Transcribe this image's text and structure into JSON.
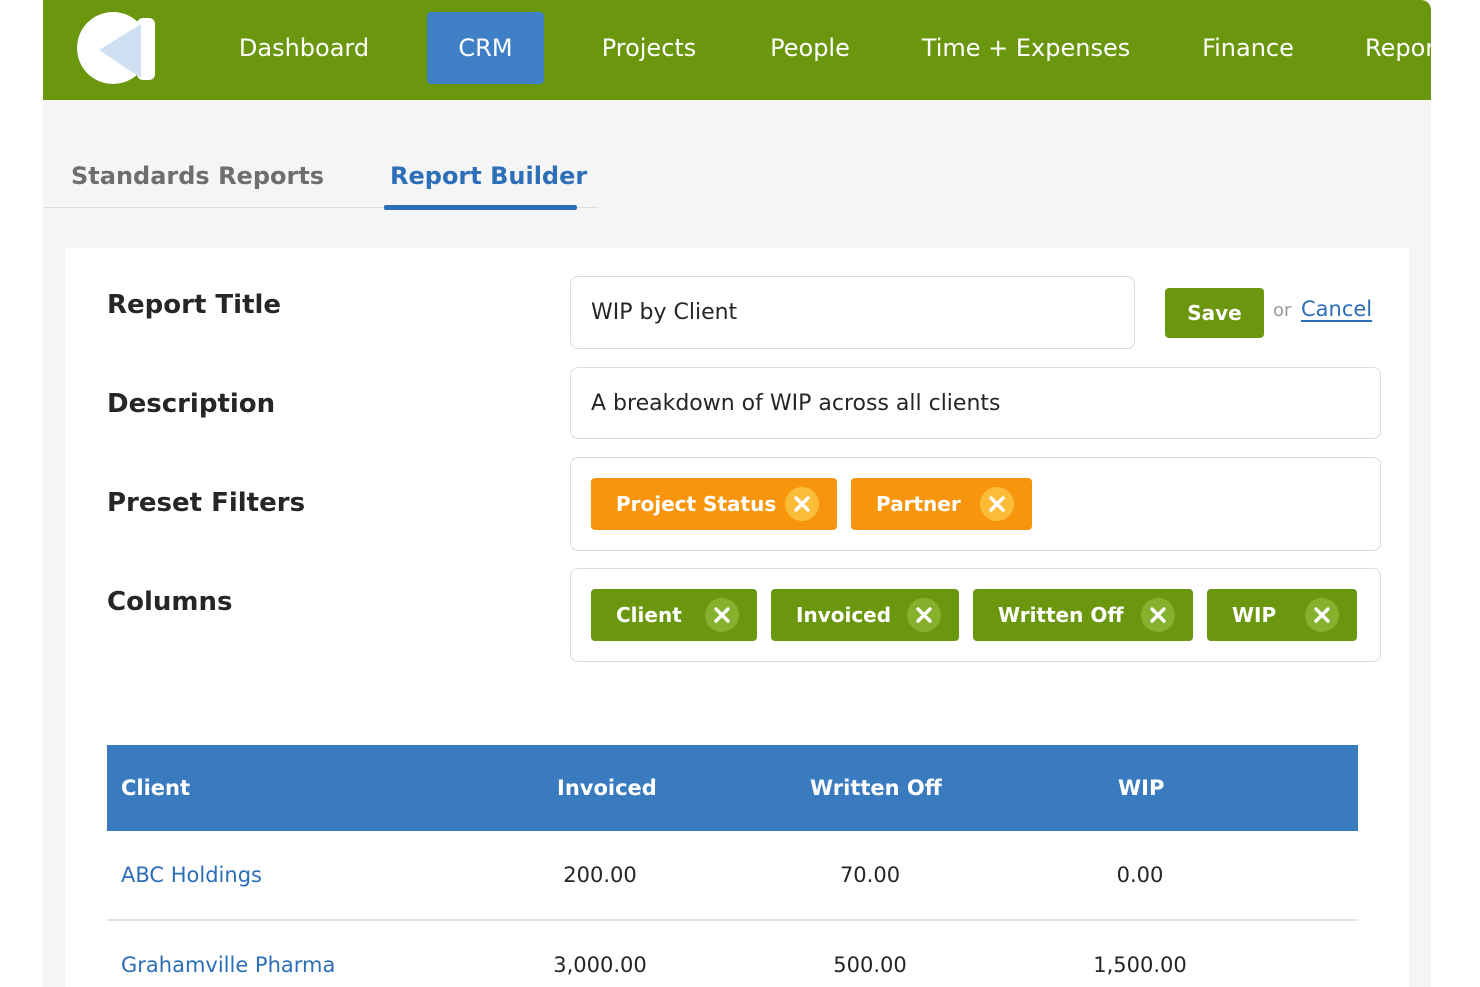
{
  "nav": {
    "items": [
      {
        "label": "Dashboard"
      },
      {
        "label": "CRM",
        "active": true
      },
      {
        "label": "Projects"
      },
      {
        "label": "People"
      },
      {
        "label": "Time + Expenses"
      },
      {
        "label": "Finance"
      },
      {
        "label": "Repor"
      }
    ],
    "accent_color": "#6b970f",
    "active_color": "#3f7fc6"
  },
  "tabs": [
    {
      "label": "Standards Reports",
      "active": false
    },
    {
      "label": "Report Builder",
      "active": true
    }
  ],
  "form": {
    "report_title_label": "Report Title",
    "report_title_value": "WIP by Client",
    "save_label": "Save",
    "or_text": "or",
    "cancel_label": "Cancel",
    "description_label": "Description",
    "description_value": "A breakdown of WIP across all clients",
    "preset_filters_label": "Preset Filters",
    "preset_filters": [
      "Project Status",
      "Partner"
    ],
    "columns_label": "Columns",
    "columns": [
      "Client",
      "Invoiced",
      "Written Off",
      "WIP"
    ],
    "filter_chip_color": "#f7960d",
    "column_chip_color": "#6b970f"
  },
  "table": {
    "headers": [
      "Client",
      "Invoiced",
      "Written Off",
      "WIP"
    ],
    "rows": [
      {
        "client": "ABC Holdings",
        "invoiced": "200.00",
        "written_off": "70.00",
        "wip": "0.00"
      },
      {
        "client": "Grahamville Pharma",
        "invoiced": "3,000.00",
        "written_off": "500.00",
        "wip": "1,500.00"
      }
    ],
    "header_color": "#3a7bc0"
  }
}
